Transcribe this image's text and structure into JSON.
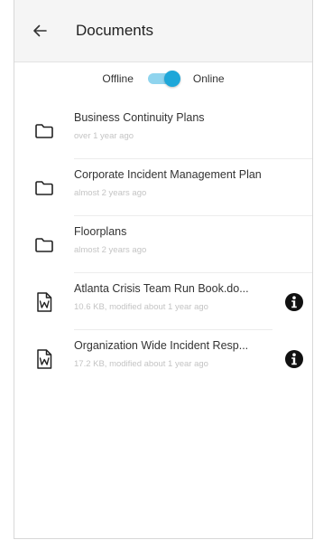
{
  "header": {
    "title": "Documents",
    "back_icon": "arrow-left-icon"
  },
  "toggle": {
    "left_label": "Offline",
    "right_label": "Online",
    "state": "Online",
    "color": "#1ea7d9"
  },
  "items": [
    {
      "title": "Business Continuity Plans",
      "subtitle": "over 1 year ago",
      "icon": "folder-icon"
    },
    {
      "title": "Corporate Incident Management Plan",
      "subtitle": "almost 2 years ago",
      "icon": "folder-icon"
    },
    {
      "title": "Floorplans",
      "subtitle": "almost 2 years ago",
      "icon": "folder-icon"
    },
    {
      "title": "Atlanta Crisis Team Run Book.do...",
      "subtitle": "10.6 KB, modified about 1 year ago",
      "icon": "word-document-icon",
      "action_icon": "info-icon"
    },
    {
      "title": "Organization Wide Incident Resp...",
      "subtitle": "17.2 KB, modified about 1 year ago",
      "icon": "word-document-icon",
      "action_icon": "info-icon"
    }
  ]
}
